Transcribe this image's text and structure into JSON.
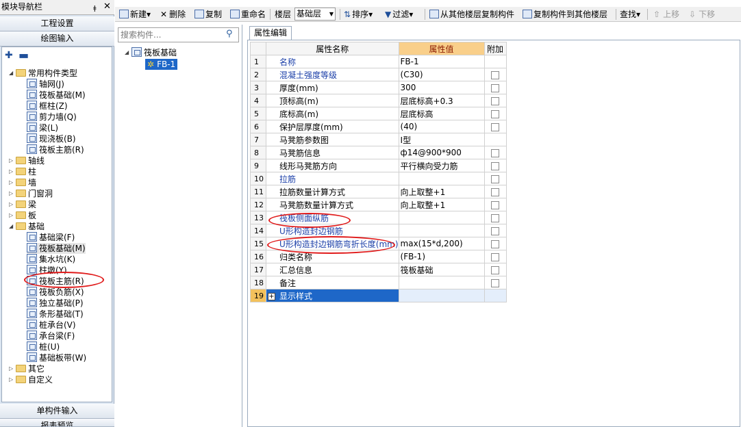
{
  "nav": {
    "title": "模块导航栏",
    "pin": "ǂ",
    "close": "✕",
    "btn_project": "工程设置",
    "btn_drawing": "绘图输入",
    "btn_single": "单构件输入",
    "btn_report": "报表预览",
    "tree": [
      {
        "label": "常用构件类型",
        "type": "folder",
        "expanded": true,
        "level": 0
      },
      {
        "label": "轴网(J)",
        "type": "item",
        "level": 1
      },
      {
        "label": "筏板基础(M)",
        "type": "item",
        "level": 1
      },
      {
        "label": "框柱(Z)",
        "type": "item",
        "level": 1
      },
      {
        "label": "剪力墙(Q)",
        "type": "item",
        "level": 1
      },
      {
        "label": "梁(L)",
        "type": "item",
        "level": 1
      },
      {
        "label": "现浇板(B)",
        "type": "item",
        "level": 1
      },
      {
        "label": "筏板主筋(R)",
        "type": "item",
        "level": 1
      },
      {
        "label": "轴线",
        "type": "folder",
        "expanded": false,
        "level": 0
      },
      {
        "label": "柱",
        "type": "folder",
        "expanded": false,
        "level": 0
      },
      {
        "label": "墙",
        "type": "folder",
        "expanded": false,
        "level": 0
      },
      {
        "label": "门窗洞",
        "type": "folder",
        "expanded": false,
        "level": 0
      },
      {
        "label": "梁",
        "type": "folder",
        "expanded": false,
        "level": 0
      },
      {
        "label": "板",
        "type": "folder",
        "expanded": false,
        "level": 0
      },
      {
        "label": "基础",
        "type": "folder",
        "expanded": true,
        "level": 0
      },
      {
        "label": "基础梁(F)",
        "type": "item",
        "level": 1
      },
      {
        "label": "筏板基础(M)",
        "type": "item",
        "level": 1
      },
      {
        "label": "集水坑(K)",
        "type": "item",
        "level": 1
      },
      {
        "label": "柱墩(Y)",
        "type": "item",
        "level": 1
      },
      {
        "label": "筏板主筋(R)",
        "type": "item",
        "level": 1
      },
      {
        "label": "筏板负筋(X)",
        "type": "item",
        "level": 1
      },
      {
        "label": "独立基础(P)",
        "type": "item",
        "level": 1
      },
      {
        "label": "条形基础(T)",
        "type": "item",
        "level": 1
      },
      {
        "label": "桩承台(V)",
        "type": "item",
        "level": 1
      },
      {
        "label": "承台梁(F)",
        "type": "item",
        "level": 1
      },
      {
        "label": "桩(U)",
        "type": "item",
        "level": 1
      },
      {
        "label": "基础板带(W)",
        "type": "item",
        "level": 1
      },
      {
        "label": "其它",
        "type": "folder",
        "expanded": false,
        "level": 0
      },
      {
        "label": "自定义",
        "type": "folder",
        "expanded": false,
        "level": 0
      }
    ]
  },
  "toolbar": {
    "new": "新建",
    "delete": "删除",
    "copy": "复制",
    "rename": "重命名",
    "floor_label": "楼层",
    "floor_value": "基础层",
    "sort": "排序",
    "filter": "过滤",
    "copy_from": "从其他楼层复制构件",
    "copy_to": "复制构件到其他楼层",
    "find": "查找",
    "move_up": "上移",
    "move_down": "下移"
  },
  "list": {
    "search_placeholder": "搜索构件...",
    "group": "筏板基础",
    "item": "FB-1"
  },
  "props": {
    "tab": "属性编辑",
    "headers": [
      "属性名称",
      "属性值",
      "附加"
    ],
    "rows": [
      {
        "num": "1",
        "name": "名称",
        "value": "FB-1",
        "link": true,
        "check": false
      },
      {
        "num": "2",
        "name": "混凝土强度等级",
        "value": "(C30)",
        "link": true,
        "check": true
      },
      {
        "num": "3",
        "name": "厚度(mm)",
        "value": "300",
        "link": false,
        "check": true
      },
      {
        "num": "4",
        "name": "顶标高(m)",
        "value": "层底标高+0.3",
        "link": false,
        "check": true
      },
      {
        "num": "5",
        "name": "底标高(m)",
        "value": "层底标高",
        "link": false,
        "check": true
      },
      {
        "num": "6",
        "name": "保护层厚度(mm)",
        "value": "(40)",
        "link": false,
        "check": true
      },
      {
        "num": "7",
        "name": "马凳筋参数图",
        "value": "Ⅰ型",
        "link": false,
        "check": false
      },
      {
        "num": "8",
        "name": "马凳筋信息",
        "value": "ф14@900*900",
        "link": false,
        "check": true
      },
      {
        "num": "9",
        "name": "线形马凳筋方向",
        "value": "平行横向受力筋",
        "link": false,
        "check": true
      },
      {
        "num": "10",
        "name": "拉筋",
        "value": "",
        "link": true,
        "check": true
      },
      {
        "num": "11",
        "name": "拉筋数量计算方式",
        "value": "向上取整+1",
        "link": false,
        "check": true
      },
      {
        "num": "12",
        "name": "马凳筋数量计算方式",
        "value": "向上取整+1",
        "link": false,
        "check": true
      },
      {
        "num": "13",
        "name": "筏板侧面纵筋",
        "value": "",
        "link": true,
        "check": true
      },
      {
        "num": "14",
        "name": "U形构造封边钢筋",
        "value": "",
        "link": true,
        "check": true
      },
      {
        "num": "15",
        "name": "U形构造封边钢筋弯折长度(mm)",
        "value": "max(15*d,200)",
        "link": true,
        "check": true
      },
      {
        "num": "16",
        "name": "归类名称",
        "value": "(FB-1)",
        "link": false,
        "check": true
      },
      {
        "num": "17",
        "name": "汇总信息",
        "value": "筏板基础",
        "link": false,
        "check": true
      },
      {
        "num": "18",
        "name": "备注",
        "value": "",
        "link": false,
        "check": true
      },
      {
        "num": "19",
        "name": "显示样式",
        "value": "",
        "link": false,
        "check": false,
        "selected": true
      }
    ]
  }
}
